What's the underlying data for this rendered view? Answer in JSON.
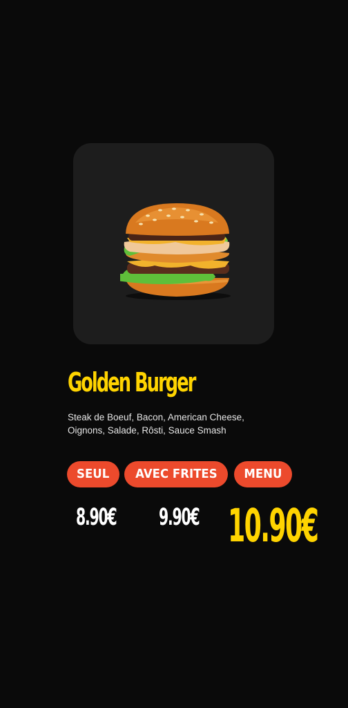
{
  "product": {
    "name": "Golden Burger",
    "description": "Steak de Boeuf, Bacon, American Cheese, Oignons, Salade, Rôsti, Sauce Smash",
    "image": "burger-photo"
  },
  "options": [
    {
      "label": "SEUL",
      "price": "8.90€"
    },
    {
      "label": "AVEC FRITES",
      "price": "9.90€"
    },
    {
      "label": "MENU",
      "price": "10.90€"
    }
  ],
  "colors": {
    "background": "#0a0a0a",
    "card": "#1d1d1d",
    "accent_yellow": "#ffd400",
    "pill_red": "#ec4a2c",
    "text_light": "#e6e6e6"
  }
}
